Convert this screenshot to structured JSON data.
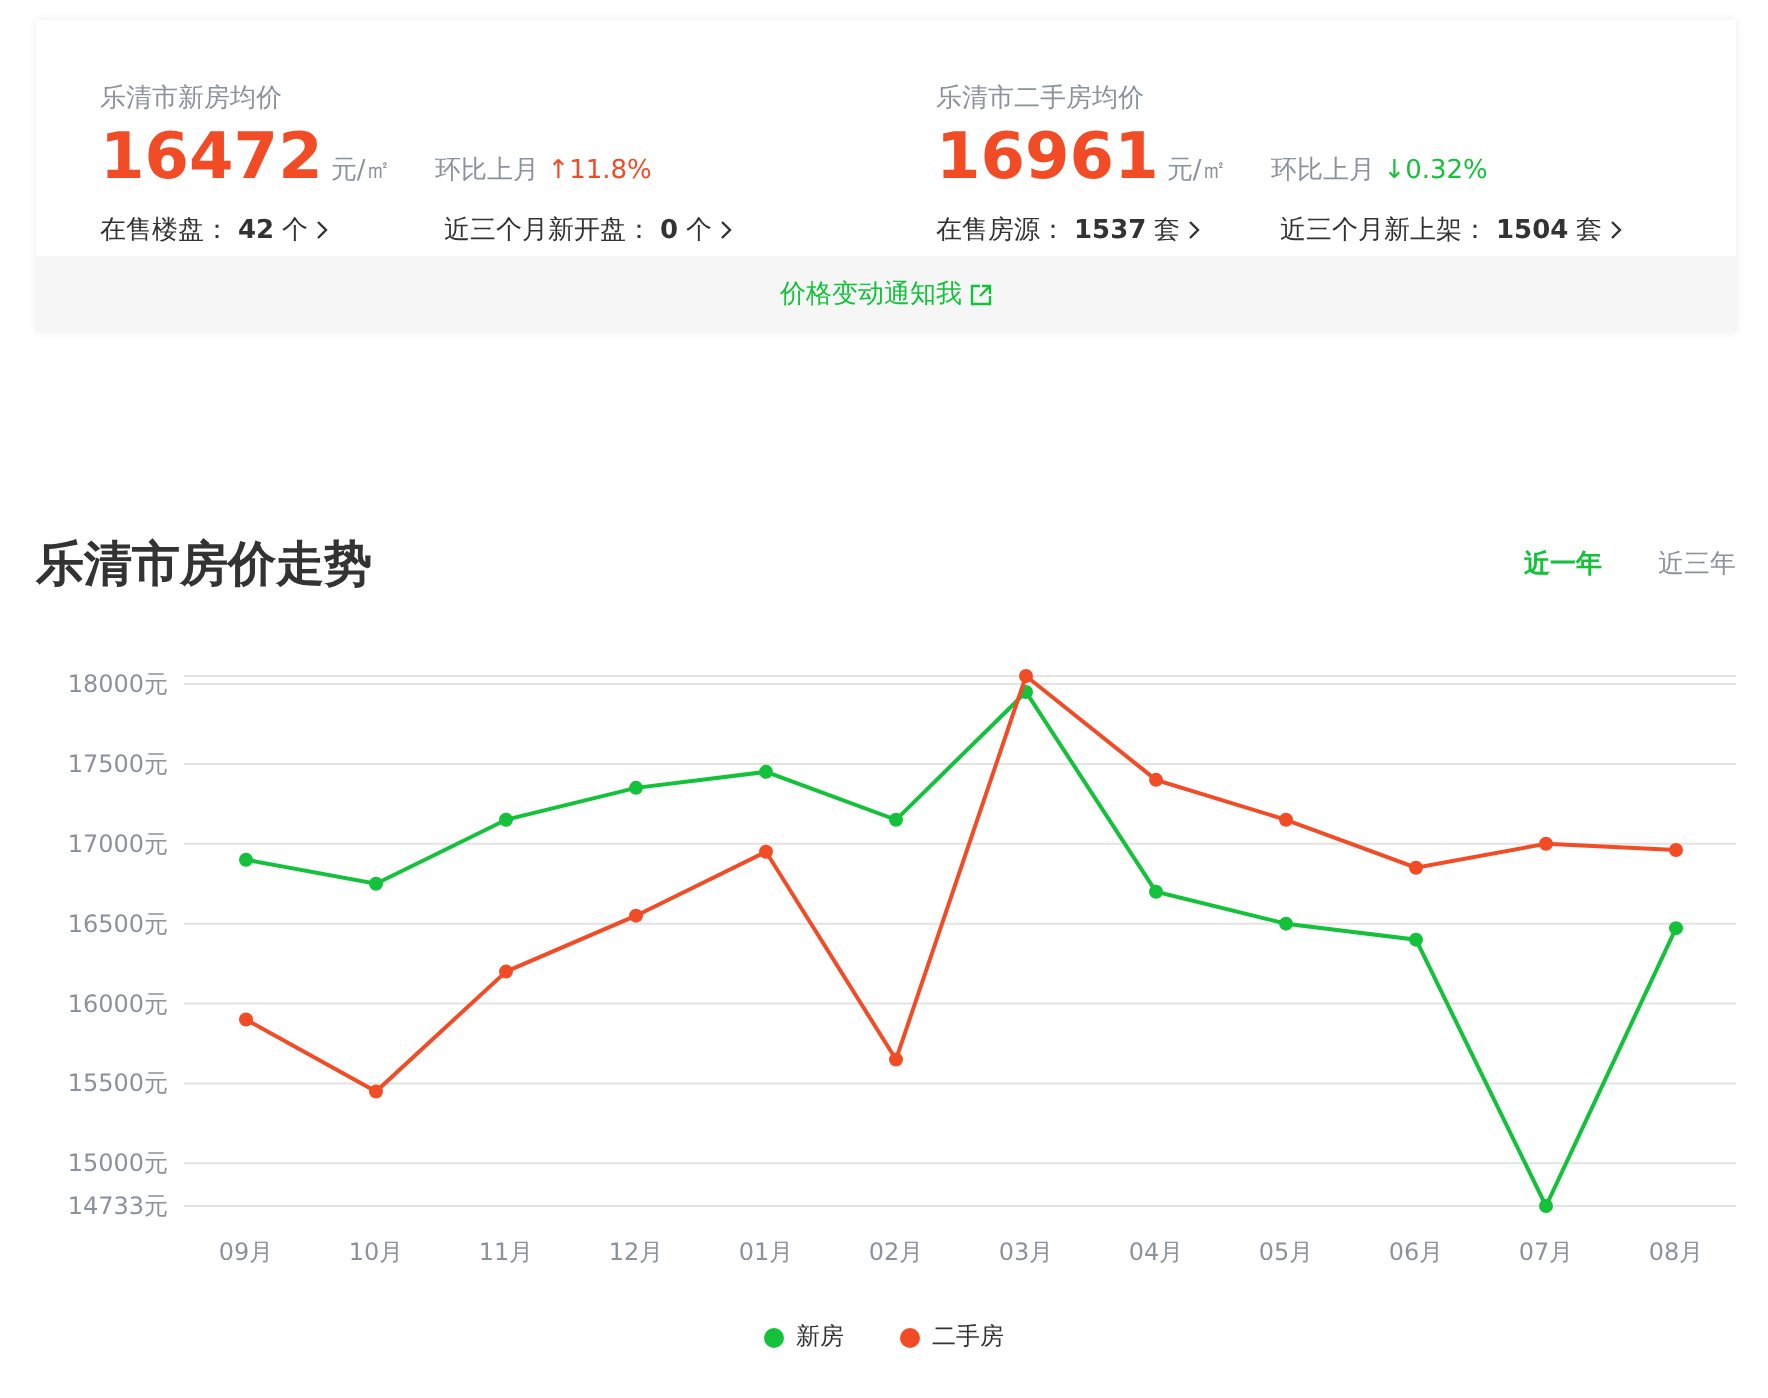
{
  "summary": [
    {
      "title": "乐清市新房均价",
      "price": "16472",
      "unit": "元/㎡",
      "change_label": "环比上月",
      "rising": true,
      "change": "↑11.8%",
      "links": [
        {
          "label": "在售楼盘：",
          "value": "42",
          "unit": "个"
        },
        {
          "label": "近三个月新开盘：",
          "value": "0",
          "unit": "个"
        }
      ]
    },
    {
      "title": "乐清市二手房均价",
      "price": "16961",
      "unit": "元/㎡",
      "change_label": "环比上月",
      "rising": false,
      "change": "↓0.32%",
      "links": [
        {
          "label": "在售房源：",
          "value": "1537",
          "unit": "套"
        },
        {
          "label": "近三个月新上架：",
          "value": "1504",
          "unit": "套"
        }
      ]
    }
  ],
  "notify": "价格变动通知我",
  "trend": {
    "title": "乐清市房价走势",
    "tabs": [
      {
        "label": "近一年",
        "selected": true
      },
      {
        "label": "近三年",
        "selected": false
      }
    ],
    "chart_data": {
      "type": "line",
      "grid": true,
      "categories": [
        "09月",
        "10月",
        "11月",
        "12月",
        "01月",
        "02月",
        "03月",
        "04月",
        "05月",
        "06月",
        "07月",
        "08月"
      ],
      "series": [
        {
          "name": "新房",
          "color": "#13c23a",
          "marker": "circle",
          "values": [
            16900,
            16750,
            17150,
            17350,
            17450,
            17150,
            17950,
            16700,
            16500,
            16400,
            14733,
            16472
          ]
        },
        {
          "name": "二手房",
          "color": "#f24c27",
          "marker": "circle",
          "values": [
            15900,
            15450,
            16200,
            16550,
            16950,
            15650,
            18050,
            17400,
            17150,
            16850,
            17000,
            16961
          ]
        }
      ],
      "ylim": [
        14733,
        18050
      ],
      "yticks": [
        {
          "value": 14733,
          "label": "14733元"
        },
        {
          "value": 15000,
          "label": "15000元"
        },
        {
          "value": 15500,
          "label": "15500元"
        },
        {
          "value": 16000,
          "label": "16000元"
        },
        {
          "value": 16500,
          "label": "16500元"
        },
        {
          "value": 17000,
          "label": "17000元"
        },
        {
          "value": 17500,
          "label": "17500元"
        },
        {
          "value": 18000,
          "label": "18000元"
        }
      ]
    }
  }
}
